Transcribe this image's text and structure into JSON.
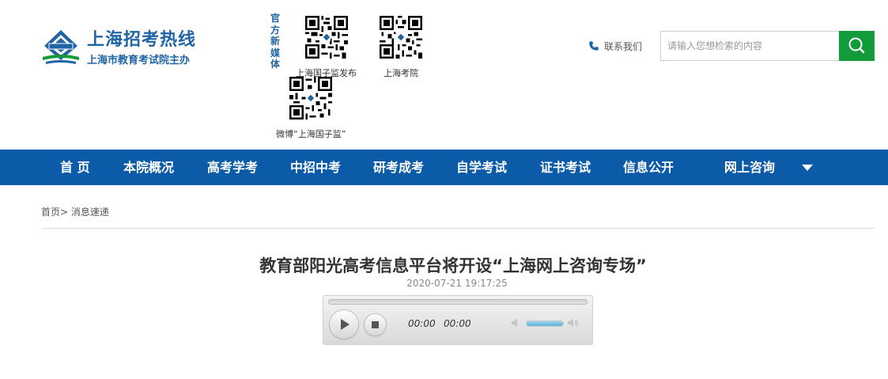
{
  "header": {
    "logo_title": "上海招考热线",
    "logo_subtitle": "上海市教育考试院主办",
    "media_label": "官方新媒体",
    "qr_codes": [
      {
        "caption": "上海国子监发布"
      },
      {
        "caption": "上海考院"
      },
      {
        "caption": "微博“上海国子监”"
      }
    ],
    "contact_label": "联系我们",
    "search_placeholder": "请输入您想检索的内容",
    "colors": {
      "brand_blue": "#1f65a6",
      "search_green": "#139b3b"
    }
  },
  "nav": {
    "items": [
      "首 页",
      "本院概况",
      "高考学考",
      "中招中考",
      "研考成考",
      "自学考试",
      "证书考试",
      "信息公开",
      "网上咨询"
    ],
    "background": "#0c5ba8"
  },
  "breadcrumb": {
    "home": "首页",
    "separator": ">",
    "current": "消息速递"
  },
  "article": {
    "title": "教育部阳光高考信息平台将开设“上海网上咨询专场”",
    "date": "2020-07-21 19:17:25"
  },
  "player": {
    "current_time": "00:00",
    "duration": "00:00",
    "progress": 0,
    "volume": 0.8
  }
}
